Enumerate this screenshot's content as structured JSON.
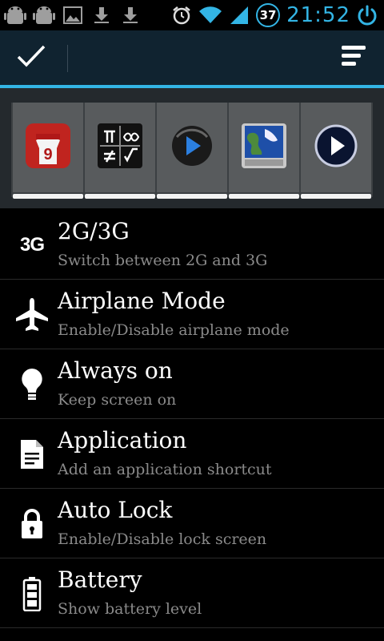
{
  "status_bar": {
    "left_icons": [
      "android-icon",
      "android-icon",
      "image-icon",
      "download-icon",
      "download-icon"
    ],
    "badge_value": "37",
    "time": "21:52"
  },
  "colors": {
    "accent": "#33b5e5",
    "actionbar_bg": "#102330",
    "tray_bg": "#24292d",
    "list_bg": "#000000"
  },
  "shortcuts": [
    {
      "name": "com2us-baseball-app-icon"
    },
    {
      "name": "math-symbols-app-icon"
    },
    {
      "name": "media-player-app-icon"
    },
    {
      "name": "weather-globe-app-icon"
    },
    {
      "name": "video-player-app-icon"
    }
  ],
  "items": [
    {
      "icon": "3G",
      "title": "2G/3G",
      "subtitle": "Switch between 2G and 3G"
    },
    {
      "title": "Airplane Mode",
      "subtitle": "Enable/Disable airplane mode"
    },
    {
      "title": "Always on",
      "subtitle": "Keep screen on"
    },
    {
      "title": "Application",
      "subtitle": "Add an application shortcut"
    },
    {
      "title": "Auto Lock",
      "subtitle": "Enable/Disable lock screen"
    },
    {
      "title": "Battery",
      "subtitle": "Show battery level"
    }
  ]
}
